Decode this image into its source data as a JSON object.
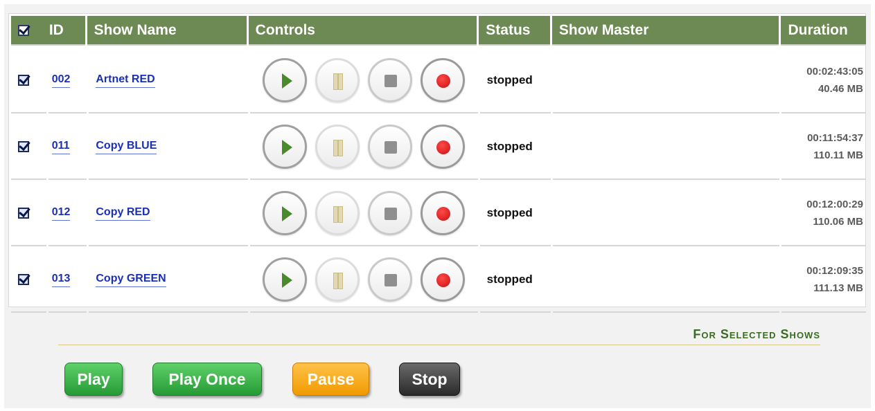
{
  "table": {
    "headers": {
      "id": "ID",
      "show_name": "Show Name",
      "controls": "Controls",
      "status": "Status",
      "show_master": "Show Master",
      "duration": "Duration"
    },
    "select_all_checked": true,
    "rows": [
      {
        "checked": true,
        "id": "002",
        "name": "Artnet RED",
        "status": "stopped",
        "show_master": "",
        "duration": "00:02:43:05",
        "size": "40.46 MB"
      },
      {
        "checked": true,
        "id": "011",
        "name": "Copy BLUE",
        "status": "stopped",
        "show_master": "",
        "duration": "00:11:54:37",
        "size": "110.11 MB"
      },
      {
        "checked": true,
        "id": "012",
        "name": "Copy RED",
        "status": "stopped",
        "show_master": "",
        "duration": "00:12:00:29",
        "size": "110.06 MB"
      },
      {
        "checked": true,
        "id": "013",
        "name": "Copy GREEN",
        "status": "stopped",
        "show_master": "",
        "duration": "00:12:09:35",
        "size": "111.13 MB"
      }
    ],
    "control_icons": [
      "play-icon",
      "pause-icon",
      "stop-icon",
      "record-icon"
    ]
  },
  "bulk_actions": {
    "heading": "For Selected Shows",
    "play": "Play",
    "play_once": "Play Once",
    "pause": "Pause",
    "stop": "Stop"
  },
  "colors": {
    "header_bg": "#6d8a55",
    "link": "#1a2fb8",
    "play_green": "#269a35",
    "pause_orange": "#f09a00",
    "stop_dark": "#2a2a2a",
    "record_red": "#c80f0f"
  }
}
